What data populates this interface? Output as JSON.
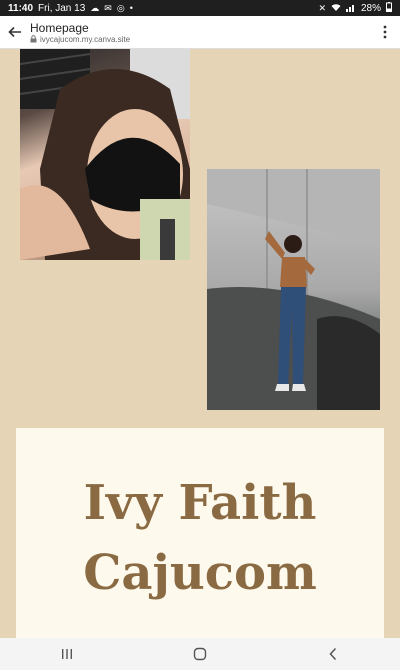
{
  "status_bar": {
    "time": "11:40",
    "date": "Fri, Jan 13",
    "battery": "28%"
  },
  "browser": {
    "page_title": "Homepage",
    "url": "ivycajucom.my.canva.site"
  },
  "main": {
    "name_line1": "Ivy Faith",
    "name_line2": "Cajucom"
  },
  "colors": {
    "page_background": "#e6d4b6",
    "card_background": "#fdf9ec",
    "name_text": "#8a6a42"
  },
  "icons": {
    "back": "arrow-left-icon",
    "lock": "lock-icon",
    "menu": "more-vert-icon",
    "nav_recents": "recents-icon",
    "nav_home": "home-icon",
    "nav_back": "back-chevron-icon"
  }
}
